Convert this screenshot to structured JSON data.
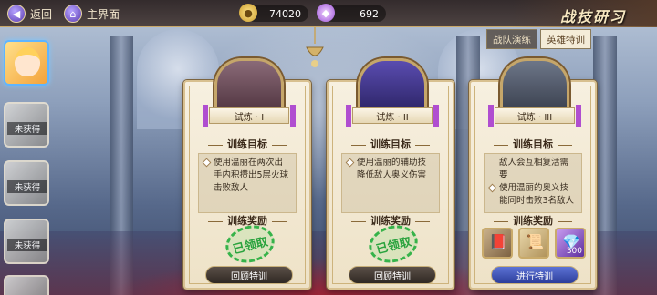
{
  "topbar": {
    "back_label": "返回",
    "home_label": "主界面",
    "gold": "74020",
    "gems": "692",
    "title": "战技研习"
  },
  "tabs": [
    {
      "label": "战队演练",
      "active": false
    },
    {
      "label": "英雄特训",
      "active": true
    }
  ],
  "sidebar": {
    "locked_label": "未获得",
    "locked_count": 4
  },
  "cards": [
    {
      "name": "试炼 · I",
      "goal_title": "训练目标",
      "goals": [
        "使用温丽在两次出手内积攒出5层火球击败敌人"
      ],
      "reward_title": "训练奖励",
      "stamp": "已领取",
      "button": "回顾特训",
      "state": "claimed",
      "emblem_color": "#6b4a5a"
    },
    {
      "name": "试炼 · II",
      "goal_title": "训练目标",
      "goals": [
        "使用温丽的辅助技降低敌人奥义伤害"
      ],
      "reward_title": "训练奖励",
      "stamp": "已领取",
      "button": "回顾特训",
      "state": "claimed",
      "emblem_color": "#3d3488"
    },
    {
      "name": "试炼 · III",
      "goal_title": "训练目标",
      "goals": [
        "敌人会互相复活需要",
        "使用温丽的奥义技能同时击败3名敌人"
      ],
      "reward_title": "训练奖励",
      "button": "进行特训",
      "state": "available",
      "emblem_color": "#4d5566",
      "rewards": [
        {
          "icon": "skill-book-icon",
          "glyph": "📕",
          "count": "",
          "color": "#8b7454"
        },
        {
          "icon": "scroll-icon",
          "glyph": "📜",
          "count": "",
          "color": "#b89a62"
        },
        {
          "icon": "gem-icon",
          "glyph": "💎",
          "count": "300",
          "color": "#8e5ad1"
        }
      ]
    }
  ]
}
